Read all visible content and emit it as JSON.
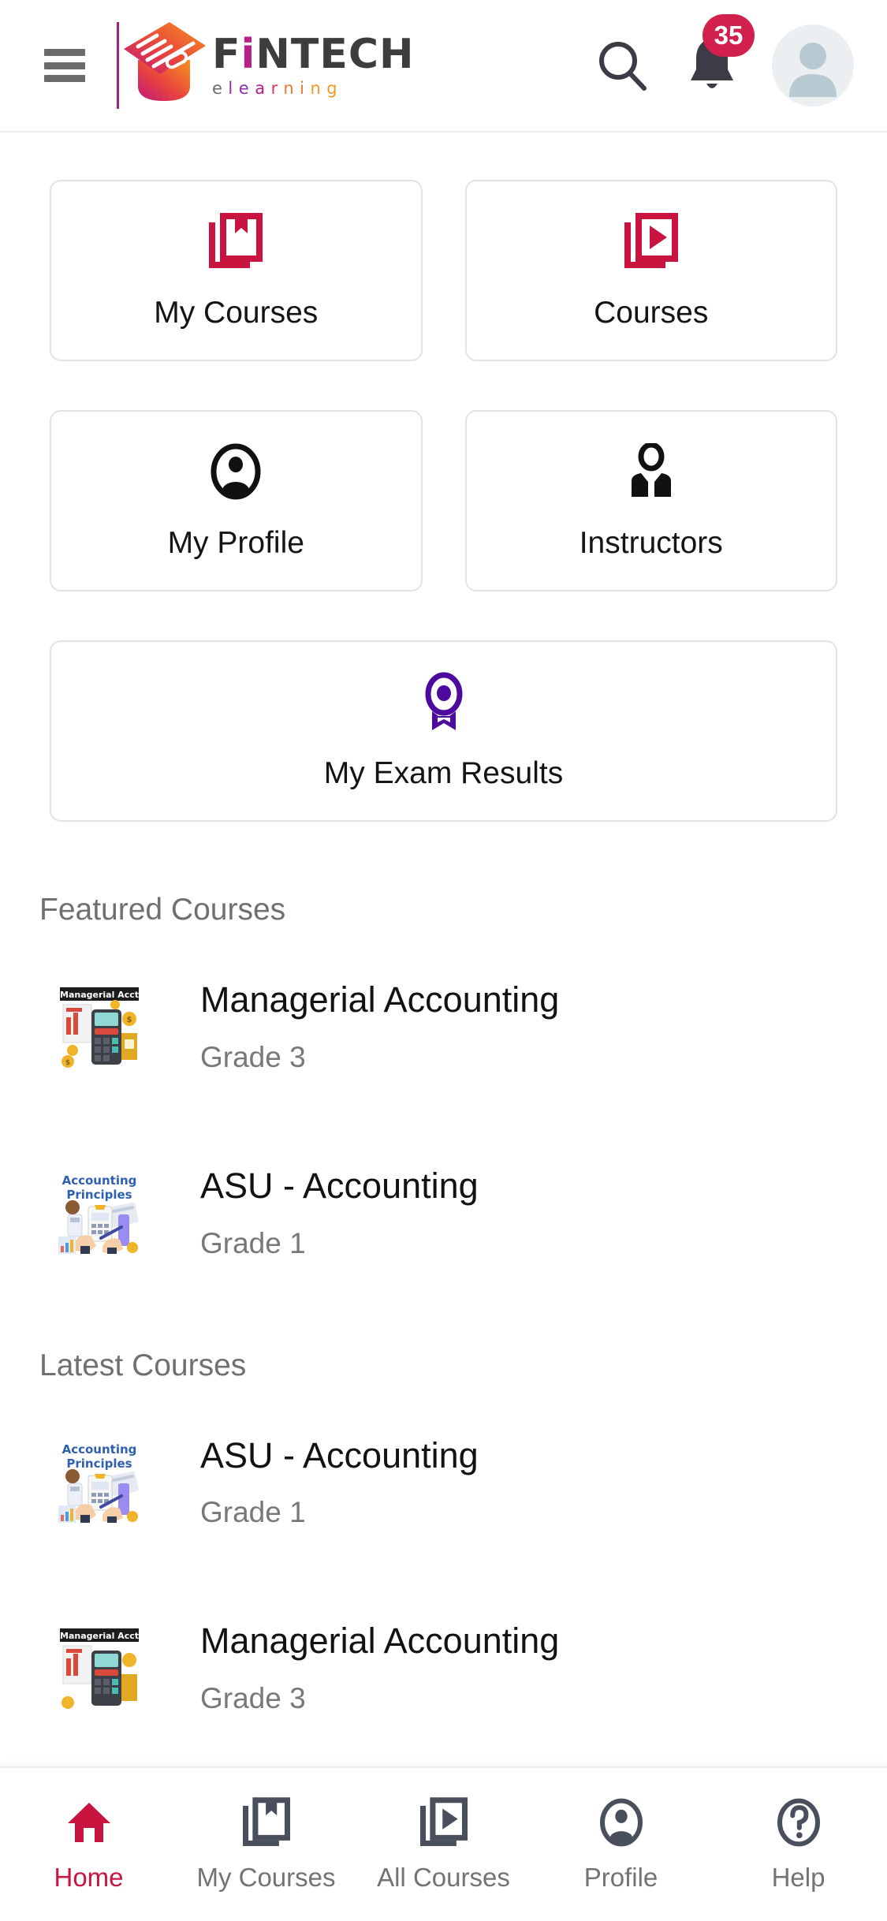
{
  "brand": {
    "name_part1": "F",
    "name_i": "i",
    "name_part2": "NTECH",
    "tagline_letters": [
      "e",
      "l",
      "e",
      "a",
      "r",
      "n",
      "i",
      "n",
      "g"
    ],
    "logo_icon": "graduation-cap-icon",
    "colors": {
      "crimson": "#c9143f",
      "badge_red": "#d0204b",
      "purple": "#4c0b9e",
      "magenta": "#b5208a",
      "orange": "#f59a1f",
      "gray_text": "#707070"
    }
  },
  "header": {
    "menu_icon": "hamburger-menu-icon",
    "search_icon": "search-icon",
    "notifications_icon": "bell-icon",
    "notifications_count": "35",
    "avatar_icon": "user-avatar-icon"
  },
  "tiles": [
    {
      "label": "My Courses",
      "icon": "book-bookmark-icon",
      "color": "#c9143f"
    },
    {
      "label": "Courses",
      "icon": "video-play-icon",
      "color": "#c9143f"
    },
    {
      "label": "My Profile",
      "icon": "account-circle-icon",
      "color": "#111111"
    },
    {
      "label": "Instructors",
      "icon": "instructor-tie-icon",
      "color": "#111111"
    },
    {
      "label": "My Exam Results",
      "icon": "award-ribbon-icon",
      "color": "#4c0b9e"
    }
  ],
  "sections": [
    {
      "title": "Featured Courses",
      "courses": [
        {
          "title": "Managerial Accounting",
          "grade": "Grade 3",
          "thumb": "managerial-accounting-thumb"
        },
        {
          "title": "ASU - Accounting",
          "grade": "Grade 1",
          "thumb": "accounting-principles-thumb"
        }
      ]
    },
    {
      "title": "Latest Courses",
      "courses": [
        {
          "title": "ASU - Accounting",
          "grade": "Grade 1",
          "thumb": "accounting-principles-thumb"
        },
        {
          "title": "Managerial Accounting",
          "grade": "Grade 3",
          "thumb": "managerial-accounting-thumb"
        }
      ]
    }
  ],
  "thumb_labels": {
    "managerial": "Managerial Accounting",
    "principles_line1": "Accounting",
    "principles_line2": "Principles"
  },
  "bottom_nav": [
    {
      "label": "Home",
      "icon": "home-icon",
      "active": true
    },
    {
      "label": "My Courses",
      "icon": "book-bookmark-icon",
      "active": false
    },
    {
      "label": "All Courses",
      "icon": "video-play-icon",
      "active": false
    },
    {
      "label": "Profile",
      "icon": "account-circle-icon",
      "active": false
    },
    {
      "label": "Help",
      "icon": "help-circle-icon",
      "active": false
    }
  ]
}
